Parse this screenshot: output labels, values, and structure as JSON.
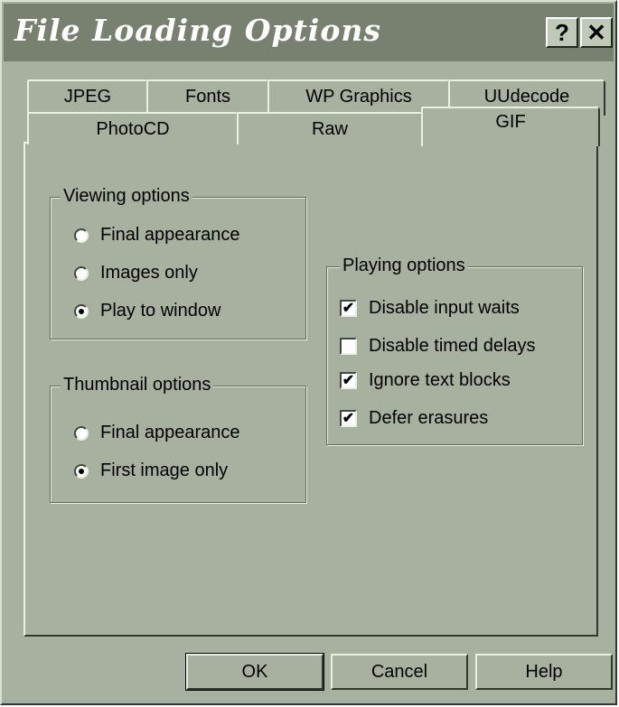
{
  "window": {
    "title": "File Loading Options",
    "help_label": "?",
    "close_label": "✕"
  },
  "tabs": {
    "back_row": [
      "JPEG",
      "Fonts",
      "WP Graphics",
      "UUdecode"
    ],
    "front_row": [
      "PhotoCD",
      "Raw",
      "GIF"
    ],
    "active": "GIF"
  },
  "viewing_options": {
    "legend": "Viewing options",
    "options": [
      {
        "label": "Final appearance",
        "selected": false
      },
      {
        "label": "Images only",
        "selected": false
      },
      {
        "label": "Play to window",
        "selected": true
      }
    ]
  },
  "thumbnail_options": {
    "legend": "Thumbnail options",
    "options": [
      {
        "label": "Final appearance",
        "selected": false
      },
      {
        "label": "First image only",
        "selected": true
      }
    ]
  },
  "playing_options": {
    "legend": "Playing options",
    "options": [
      {
        "label": "Disable input waits",
        "checked": true
      },
      {
        "label": "Disable timed delays",
        "checked": false
      },
      {
        "label": "Ignore text blocks",
        "checked": true
      },
      {
        "label": "Defer erasures",
        "checked": true
      }
    ]
  },
  "buttons": {
    "ok": "OK",
    "cancel": "Cancel",
    "help": "Help"
  },
  "colors": {
    "face": "#a8b0a0",
    "titlebar": "#788070"
  }
}
